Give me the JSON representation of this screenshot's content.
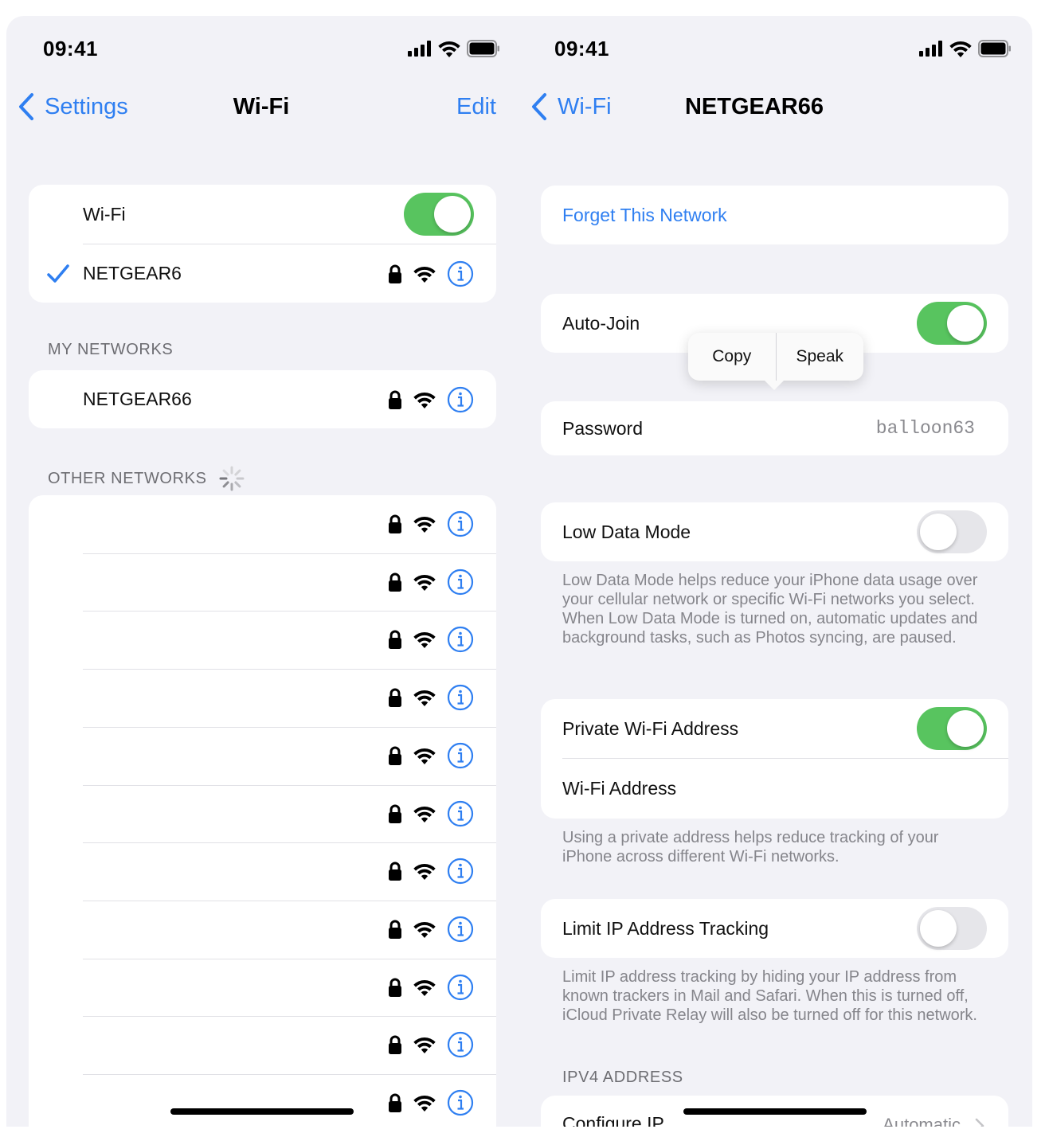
{
  "left": {
    "status_time": "09:41",
    "back_label": "Settings",
    "title": "Wi-Fi",
    "edit_label": "Edit",
    "wifi_label": "Wi-Fi",
    "wifi_on": true,
    "connected_network": "NETGEAR6",
    "my_networks_header": "MY NETWORKS",
    "my_networks": [
      "NETGEAR66"
    ],
    "other_networks_header": "OTHER NETWORKS",
    "other_networks_count": 11
  },
  "right": {
    "status_time": "09:41",
    "back_label": "Wi-Fi",
    "title": "NETGEAR66",
    "forget_label": "Forget This Network",
    "auto_join_label": "Auto-Join",
    "auto_join_on": true,
    "popup": {
      "copy": "Copy",
      "speak": "Speak"
    },
    "password_label": "Password",
    "password_value": "balloon63",
    "low_data_label": "Low Data Mode",
    "low_data_on": false,
    "low_data_note": "Low Data Mode helps reduce your iPhone data usage over your cellular network or specific Wi-Fi networks you select. When Low Data Mode is turned on, automatic updates and background tasks, such as Photos syncing, are paused.",
    "private_address_label": "Private Wi-Fi Address",
    "private_address_on": true,
    "wifi_address_label": "Wi-Fi Address",
    "private_address_note": "Using a private address helps reduce tracking of your iPhone across different Wi-Fi networks.",
    "limit_ip_label": "Limit IP Address Tracking",
    "limit_ip_on": false,
    "limit_ip_note": "Limit IP address tracking by hiding your IP address from known trackers in Mail and Safari. When this is turned off, iCloud Private Relay will also be turned off for this network.",
    "ipv4_header": "IPV4 ADDRESS",
    "configure_ip_label": "Configure IP",
    "configure_ip_value": "Automatic"
  },
  "colors": {
    "accent": "#2f7ff1",
    "toggle_on": "#58c45f",
    "background": "#f2f2f7"
  }
}
